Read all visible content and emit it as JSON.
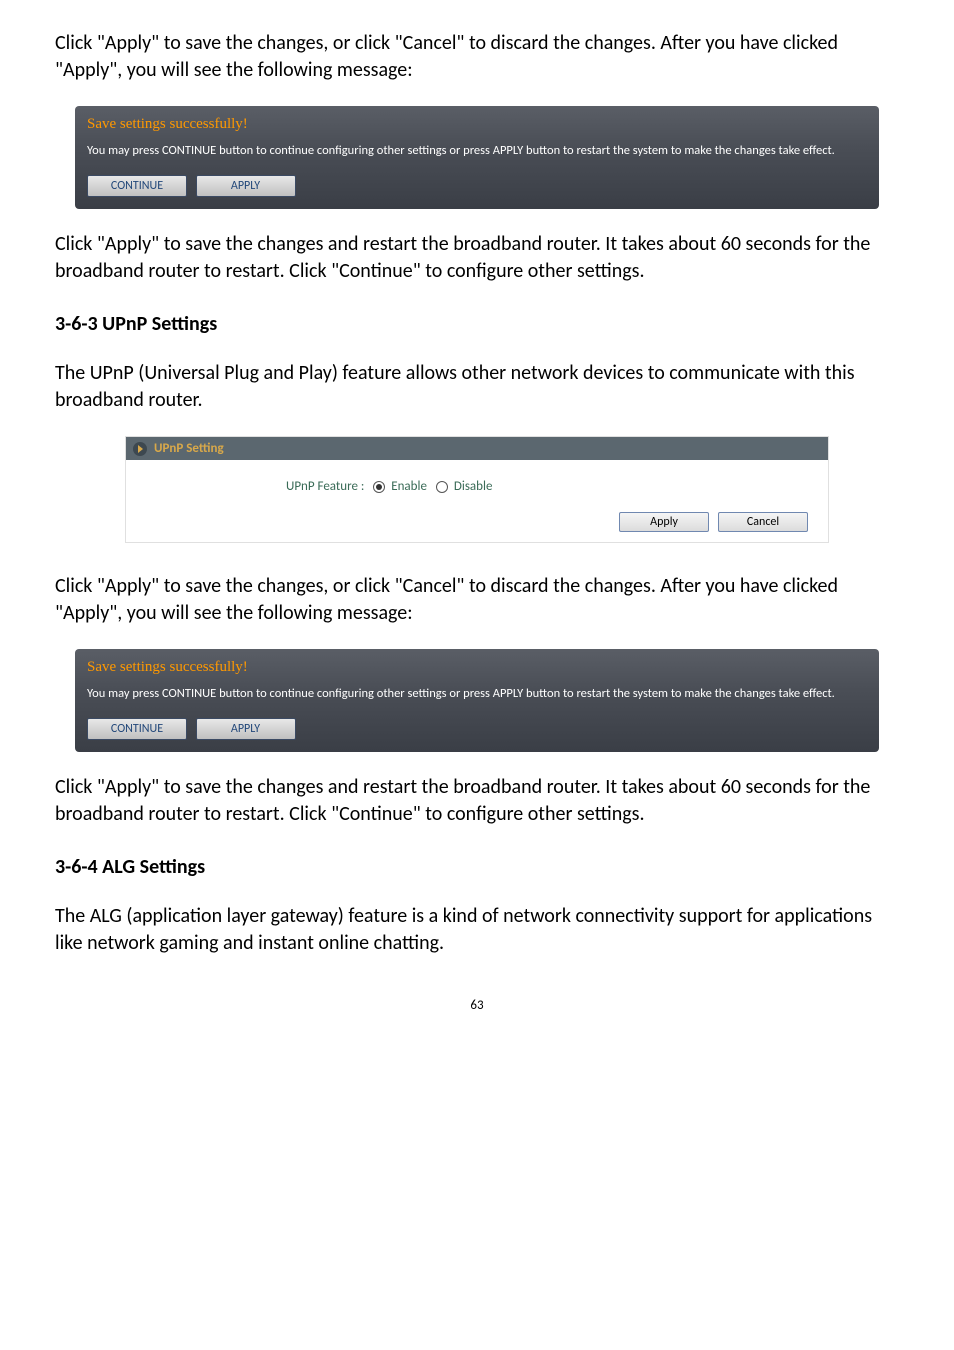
{
  "p1": "Click \"Apply\" to save the changes, or click \"Cancel\" to discard the changes. After you have clicked \"Apply\", you will see the following message:",
  "panel1": {
    "title": "Save settings successfully!",
    "text": "You may press CONTINUE button to continue configuring other settings or press APPLY button to restart the system to make the changes take effect.",
    "continue": "CONTINUE",
    "apply": "APPLY"
  },
  "p2": "Click \"Apply\" to save the changes and restart the broadband router. It takes about 60 seconds for the broadband router to restart. Click \"Continue\" to configure other settings.",
  "h1": "3-6-3 UPnP Settings",
  "p3": "The UPnP (Universal Plug and Play) feature allows other network devices to communicate with this broadband router.",
  "upnp": {
    "header": "UPnP Setting",
    "label": "UPnP Feature :",
    "enable": "Enable",
    "disable": "Disable",
    "apply": "Apply",
    "cancel": "Cancel"
  },
  "p4": "Click \"Apply\" to save the changes, or click \"Cancel\" to discard the changes. After you have clicked \"Apply\", you will see the following message:",
  "panel2": {
    "title": "Save settings successfully!",
    "text": "You may press CONTINUE button to continue configuring other settings or press APPLY button to restart the system to make the changes take effect.",
    "continue": "CONTINUE",
    "apply": "APPLY"
  },
  "p5": "Click \"Apply\" to save the changes and restart the broadband router. It takes about 60 seconds for the broadband router to restart. Click \"Continue\" to configure other settings.",
  "h2": "3-6-4 ALG Settings",
  "p6": "The ALG (application layer gateway) feature is a kind of network connectivity support for applications like network gaming and instant online chatting.",
  "pagenum": "63"
}
